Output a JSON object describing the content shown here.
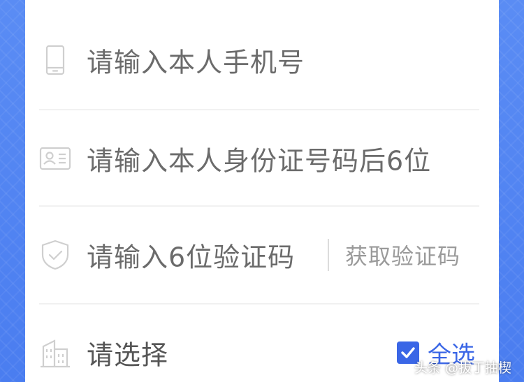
{
  "colors": {
    "background": "#4a7df0",
    "card": "#ffffff",
    "placeholder": "#6b6b6b",
    "accent": "#3a66e6",
    "muted": "#9a9a9a"
  },
  "form": {
    "phone": {
      "icon": "phone-icon",
      "placeholder": "请输入本人手机号"
    },
    "id_card": {
      "icon": "id-card-icon",
      "placeholder": "请输入本人身份证号码后6位"
    },
    "verification": {
      "icon": "shield-check-icon",
      "placeholder": "请输入6位验证码",
      "get_code_label": "获取验证码"
    },
    "department": {
      "icon": "building-icon",
      "label": "请选择",
      "select_all_label": "全选",
      "select_all_checked": true
    }
  },
  "watermark": {
    "text": "头条 @拔丁抽楔"
  }
}
